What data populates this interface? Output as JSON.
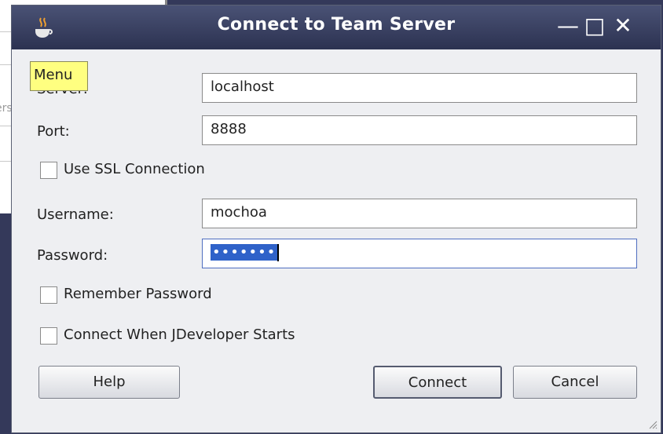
{
  "window": {
    "title": "Connect to Team Server",
    "controls": {
      "minimize": "—",
      "maximize": "□",
      "close": "✕"
    }
  },
  "background": {
    "stub_text": "ers"
  },
  "tooltip": {
    "text": "Menu"
  },
  "fields": {
    "server": {
      "label": "Server:",
      "value": "localhost"
    },
    "port": {
      "label": "Port:",
      "value": "8888"
    },
    "username": {
      "label": "Username:",
      "value": "mochoa"
    },
    "password": {
      "label": "Password:",
      "value": "•••••••"
    }
  },
  "checkboxes": {
    "use_ssl": {
      "label": "Use SSL Connection",
      "checked": false
    },
    "remember_password": {
      "label": "Remember Password",
      "checked": false
    },
    "connect_on_start": {
      "label": "Connect When JDeveloper Starts",
      "checked": false
    }
  },
  "buttons": {
    "help": "Help",
    "connect": "Connect",
    "cancel": "Cancel"
  }
}
